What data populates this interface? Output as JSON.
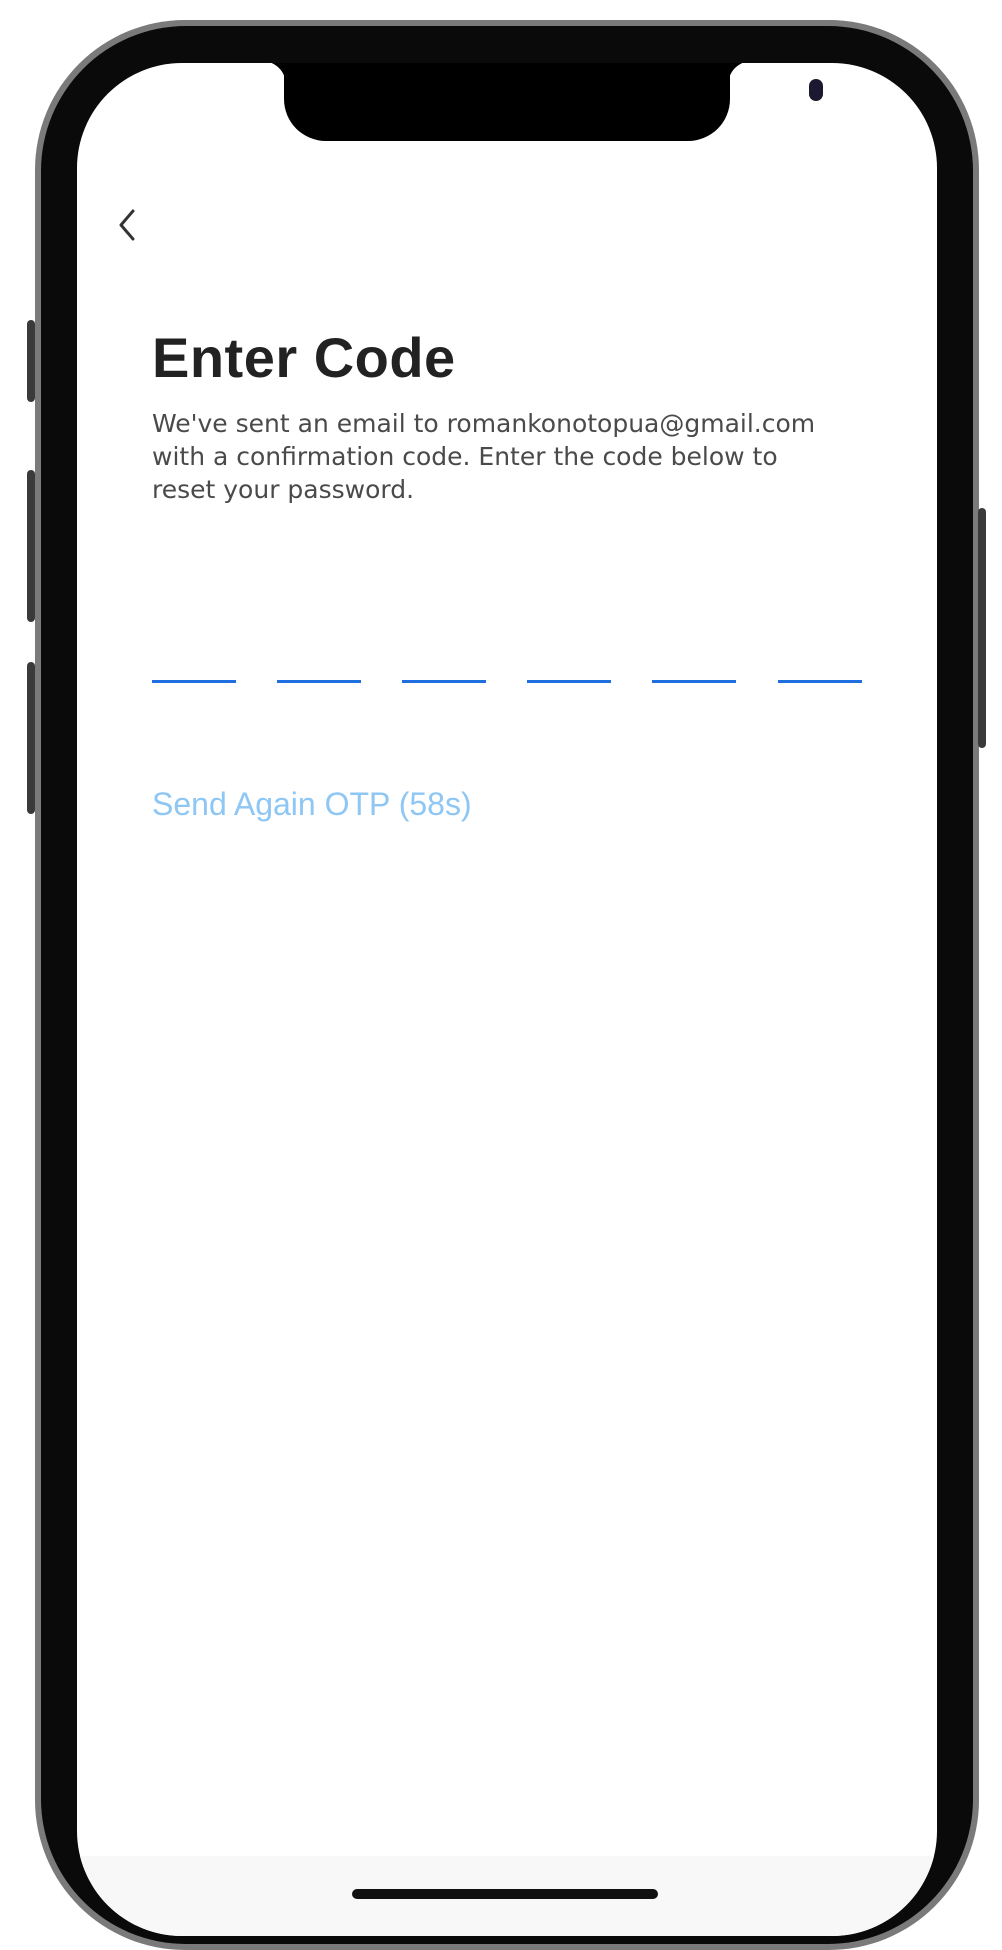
{
  "header": {
    "back_icon": "chevron-left-icon"
  },
  "main": {
    "title": "Enter Code",
    "description": "We've sent an email to romankonotopua@gmail.com\nwith a confirmation code. Enter the code below to\nreset your password.",
    "otp": {
      "digits": [
        "",
        "",
        "",
        "",
        "",
        ""
      ],
      "underline_color": "#1f6fe0"
    },
    "resend_label": "Send Again OTP (58s)",
    "resend_color": "#8ec6f4"
  },
  "colors": {
    "title": "#222222",
    "body_text": "#4a4a4a",
    "accent": "#1f6fe0"
  }
}
